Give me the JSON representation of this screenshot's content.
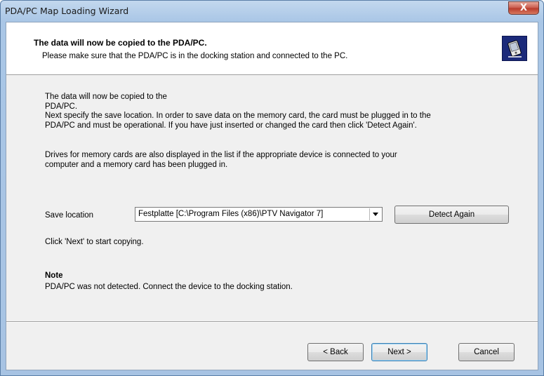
{
  "window": {
    "title": "PDA/PC Map Loading Wizard",
    "close_glyph": "X"
  },
  "header": {
    "title": "The data will now be copied to the PDA/PC.",
    "subtitle": "Please make sure that the PDA/PC is in the docking station and connected to the PC.",
    "icon": "pda-device-icon"
  },
  "body": {
    "intro_line1": "The data will now be copied to the",
    "intro_line2": "PDA/PC.",
    "intro_line3": "Next specify the save location. In order to save data on the memory card, the card must be plugged in to the",
    "intro_line4": "PDA/PC and must be operational. If you have just inserted or changed the card then click 'Detect Again'.",
    "drives_line1": "Drives for memory cards are also displayed in the list if the appropriate device is connected to your",
    "drives_line2": "computer and a memory card has been plugged in.",
    "save_location_label": "Save location",
    "save_location_value": "Festplatte [C:\\Program Files (x86)\\PTV Navigator 7]",
    "detect_again_label": "Detect Again",
    "next_hint": "Click 'Next' to start copying.",
    "note_title": "Note",
    "note_text": "PDA/PC was not detected. Connect the device to the docking station."
  },
  "footer": {
    "back_label": "< Back",
    "next_label": "Next >",
    "cancel_label": "Cancel"
  }
}
